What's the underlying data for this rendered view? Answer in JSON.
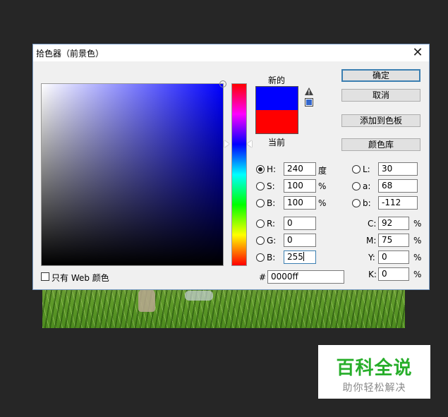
{
  "dialog": {
    "title": "拾色器（前景色）",
    "close_glyph": "✕"
  },
  "swatch": {
    "new_label": "新的",
    "current_label": "当前",
    "new_color": "#0000ff",
    "current_color": "#ff0000",
    "websafe_color": "#3366cc"
  },
  "buttons": {
    "ok": "确定",
    "cancel": "取消",
    "add_to_swatches": "添加到色板",
    "color_libraries": "颜色库"
  },
  "hsb": {
    "h_label": "H:",
    "h_value": "240",
    "h_unit": "度",
    "s_label": "S:",
    "s_value": "100",
    "s_unit": "%",
    "b_label": "B:",
    "b_value": "100",
    "b_unit": "%"
  },
  "rgb": {
    "r_label": "R:",
    "r_value": "0",
    "g_label": "G:",
    "g_value": "0",
    "b_label": "B:",
    "b_value": "255"
  },
  "lab": {
    "l_label": "L:",
    "l_value": "30",
    "a_label": "a:",
    "a_value": "68",
    "b_label": "b:",
    "b_value": "-112"
  },
  "cmyk": {
    "c_label": "C:",
    "c_value": "92",
    "c_unit": "%",
    "m_label": "M:",
    "m_value": "75",
    "m_unit": "%",
    "y_label": "Y:",
    "y_value": "0",
    "y_unit": "%",
    "k_label": "K:",
    "k_value": "0",
    "k_unit": "%"
  },
  "hex": {
    "label": "#",
    "value": "0000ff"
  },
  "web_only": {
    "label": "只有 Web 颜色"
  },
  "watermark": {
    "title": "百科全说",
    "subtitle": "助你轻松解决",
    "title_color": "#27ae2a"
  },
  "colors": {
    "field_hue": "#0000ff",
    "accent": "#3c7fb1"
  }
}
